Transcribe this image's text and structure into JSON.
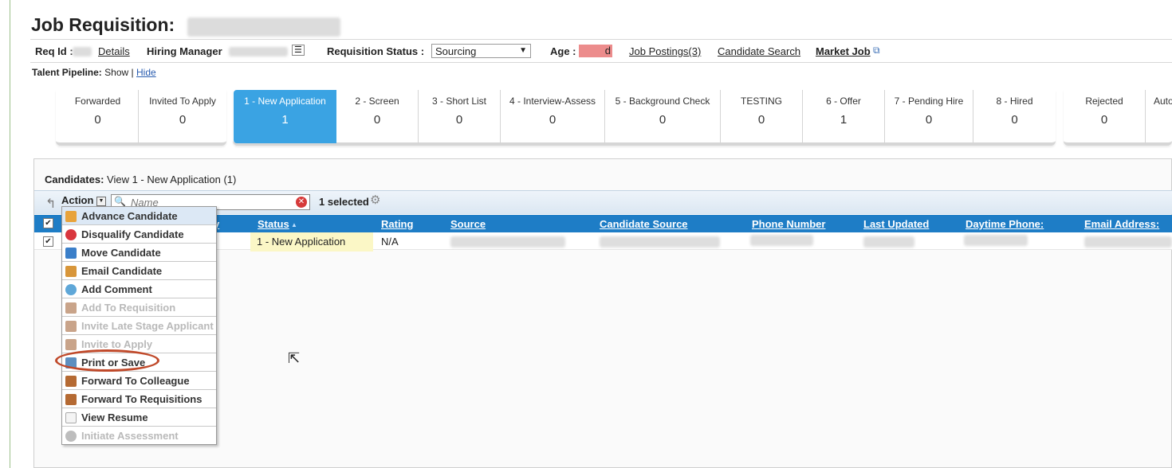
{
  "page": {
    "title": "Job Requisition:"
  },
  "req_bar": {
    "req_id_label": "Req Id :",
    "details_link": "Details",
    "hiring_manager_label": "Hiring Manager",
    "req_status_label": "Requisition Status :",
    "req_status_value": "Sourcing",
    "age_label": "Age :",
    "age_value": "d",
    "job_postings_link": "Job Postings(3)",
    "candidate_search_link": "Candidate Search",
    "market_job_link": "Market Job"
  },
  "talent_pipeline": {
    "label": "Talent Pipeline:",
    "show": "Show",
    "sep": "|",
    "hide": "Hide"
  },
  "stages": [
    {
      "name": "Forwarded",
      "count": "0"
    },
    {
      "name": "Invited To Apply",
      "count": "0"
    },
    {
      "name": "1 - New Application",
      "count": "1"
    },
    {
      "name": "2 - Screen",
      "count": "0"
    },
    {
      "name": "3 - Short List",
      "count": "0"
    },
    {
      "name": "4 - Interview-Assess",
      "count": "0"
    },
    {
      "name": "5 - Background Check",
      "count": "0"
    },
    {
      "name": "TESTING",
      "count": "0"
    },
    {
      "name": "6 - Offer",
      "count": "1"
    },
    {
      "name": "7 - Pending Hire",
      "count": "0"
    },
    {
      "name": "8 - Hired",
      "count": "0"
    },
    {
      "name": "Rejected",
      "count": "0"
    },
    {
      "name": "Auto",
      "count": ""
    }
  ],
  "candidates": {
    "header_label": "Candidates:",
    "header_view": "View 1 - New Application (1)",
    "action_label": "Action",
    "search_placeholder": "Name",
    "selected_text": "1 selected"
  },
  "grid": {
    "columns": [
      "Status",
      "Rating",
      "Source",
      "Candidate Source",
      "Phone Number",
      "Last Updated",
      "Daytime Phone:",
      "Email Address:"
    ],
    "partial_column": "y",
    "row": {
      "status": "1 - New Application",
      "rating": "N/A"
    }
  },
  "action_menu": [
    {
      "label": "Advance Candidate",
      "enabled": true,
      "icon": "thumbs-up-icon",
      "color": "#e8a33b"
    },
    {
      "label": "Disqualify Candidate",
      "enabled": true,
      "icon": "stop-icon",
      "color": "#d9363e"
    },
    {
      "label": "Move Candidate",
      "enabled": true,
      "icon": "move-arrows-icon",
      "color": "#3b7fc9"
    },
    {
      "label": "Email Candidate",
      "enabled": true,
      "icon": "envelope-icon",
      "color": "#d8963a"
    },
    {
      "label": "Add Comment",
      "enabled": true,
      "icon": "comment-add-icon",
      "color": "#5fa7d8"
    },
    {
      "label": "Add To Requisition",
      "enabled": false,
      "icon": "requisition-icon",
      "color": "#c9a48a"
    },
    {
      "label": "Invite Late Stage Applicant",
      "enabled": false,
      "icon": "invite-icon",
      "color": "#c9a48a"
    },
    {
      "label": "Invite to Apply",
      "enabled": false,
      "icon": "invite-apply-icon",
      "color": "#c9a48a"
    },
    {
      "label": "Print or Save",
      "enabled": true,
      "icon": "printer-icon",
      "color": "#5d8fc0"
    },
    {
      "label": "Forward To Colleague",
      "enabled": true,
      "icon": "forward-icon",
      "color": "#b56a33"
    },
    {
      "label": "Forward To Requisitions",
      "enabled": true,
      "icon": "forward-req-icon",
      "color": "#b56a33"
    },
    {
      "label": "View Resume",
      "enabled": true,
      "icon": "document-icon",
      "color": "#eeeeee"
    },
    {
      "label": "Initiate Assessment",
      "enabled": false,
      "icon": "assessment-icon",
      "color": "#bdbdbd"
    }
  ]
}
